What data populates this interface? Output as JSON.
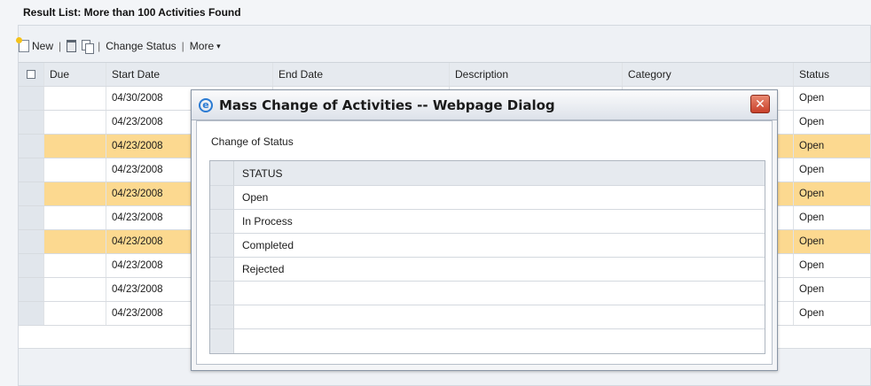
{
  "result_title": "Result List: More than 100 Activities Found",
  "toolbar": {
    "new_label": "New",
    "change_status_label": "Change Status",
    "more_label": "More",
    "more_arrow": "▾",
    "separator": "|"
  },
  "grid": {
    "headers": {
      "due": "Due",
      "start_date": "Start Date",
      "end_date": "End Date",
      "description": "Description",
      "category": "Category",
      "status": "Status"
    },
    "rows": [
      {
        "start_date": "04/30/2008",
        "status": "Open",
        "selected": false
      },
      {
        "start_date": "04/23/2008",
        "status": "Open",
        "selected": false
      },
      {
        "start_date": "04/23/2008",
        "status": "Open",
        "selected": true
      },
      {
        "start_date": "04/23/2008",
        "status": "Open",
        "selected": false
      },
      {
        "start_date": "04/23/2008",
        "status": "Open",
        "selected": true
      },
      {
        "start_date": "04/23/2008",
        "status": "Open",
        "selected": false
      },
      {
        "start_date": "04/23/2008",
        "status": "Open",
        "selected": true
      },
      {
        "start_date": "04/23/2008",
        "status": "Open",
        "selected": false
      },
      {
        "start_date": "04/23/2008",
        "status": "Open",
        "selected": false
      },
      {
        "start_date": "04/23/2008",
        "status": "Open",
        "selected": false
      }
    ]
  },
  "dialog": {
    "title": "Mass Change of Activities -- Webpage Dialog",
    "close_glyph": "✕",
    "ie_glyph": "e",
    "section_label": "Change of Status",
    "column_header": "STATUS",
    "options": [
      "Open",
      "In Process",
      "Completed",
      "Rejected",
      "",
      "",
      ""
    ]
  },
  "colors": {
    "selected_row": "#fcd990",
    "header_bg": "#e6eaef",
    "close_button": "#c8402a"
  }
}
